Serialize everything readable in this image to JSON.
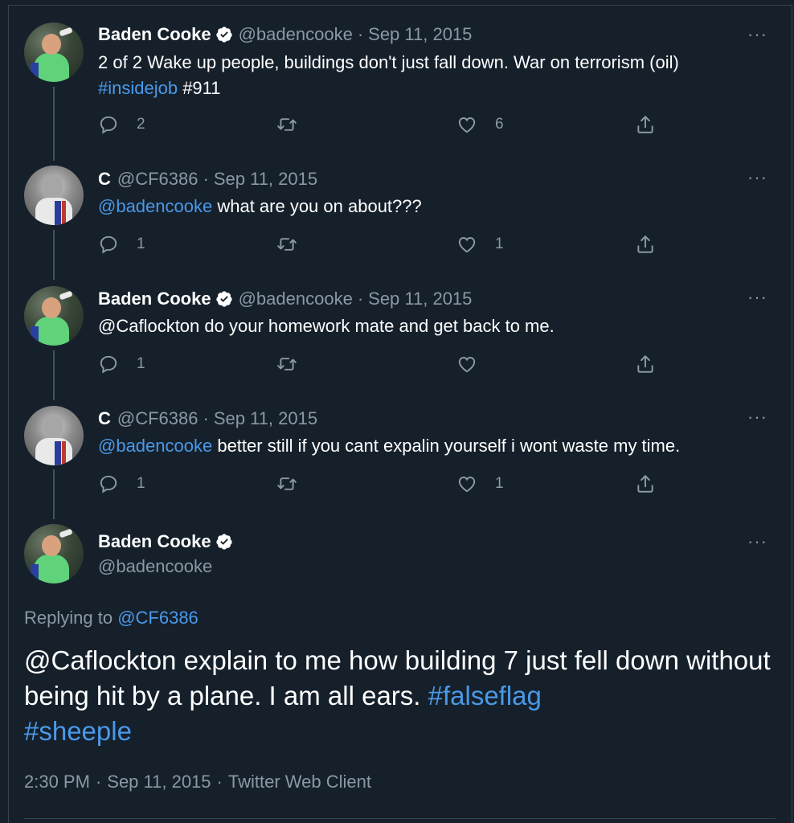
{
  "colors": {
    "background": "#15202b",
    "text": "#ffffff",
    "muted": "#8b98a5",
    "link": "#4a99e9",
    "thread_line": "#3d5466"
  },
  "tweets": [
    {
      "name": "Baden Cooke",
      "verified": true,
      "handle": "@badencooke",
      "date": "Sep 11, 2015",
      "text_plain": "2 of 2 Wake up people, buildings don't just fall down. War on terrorism (oil)",
      "text_link": "#insidejob",
      "text_tail": " #911",
      "replies": "2",
      "retweets": "",
      "likes": "6"
    },
    {
      "name": "C",
      "verified": false,
      "handle": "@CF6386",
      "date": "Sep 11, 2015",
      "mention": "@badencooke",
      "text_plain": " what are you on about???",
      "replies": "1",
      "retweets": "",
      "likes": "1"
    },
    {
      "name": "Baden Cooke",
      "verified": true,
      "handle": "@badencooke",
      "date": "Sep 11, 2015",
      "text_plain": "@Caflockton do your homework mate and get back to me.",
      "replies": "1",
      "retweets": "",
      "likes": ""
    },
    {
      "name": "C",
      "verified": false,
      "handle": "@CF6386",
      "date": "Sep 11, 2015",
      "mention": "@badencooke",
      "text_plain": " better still if you cant expalin yourself i wont waste my time.",
      "replies": "1",
      "retweets": "",
      "likes": "1"
    }
  ],
  "main_tweet": {
    "name": "Baden Cooke",
    "verified": true,
    "handle": "@badencooke",
    "replying_prefix": "Replying to ",
    "replying_to": "@CF6386",
    "text_plain": "@Caflockton explain to me how building 7 just fell down without being hit by a plane. I am all ears. ",
    "hashtag1": "#falseflag",
    "hashtag2": "#sheeple",
    "time": "2:30 PM",
    "date": "Sep 11, 2015",
    "client": "Twitter Web Client"
  },
  "more_label": "···",
  "separator": "·"
}
